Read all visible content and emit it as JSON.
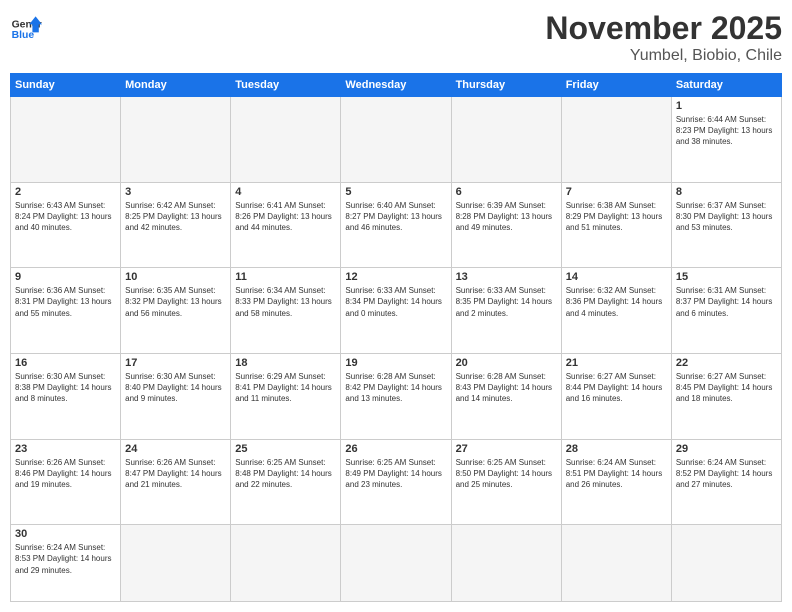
{
  "logo": {
    "general": "General",
    "blue": "Blue"
  },
  "title": "November 2025",
  "location": "Yumbel, Biobio, Chile",
  "days_header": [
    "Sunday",
    "Monday",
    "Tuesday",
    "Wednesday",
    "Thursday",
    "Friday",
    "Saturday"
  ],
  "weeks": [
    [
      {
        "day": "",
        "sunrise": "",
        "sunset": "",
        "daylight": "",
        "empty": true
      },
      {
        "day": "",
        "sunrise": "",
        "sunset": "",
        "daylight": "",
        "empty": true
      },
      {
        "day": "",
        "sunrise": "",
        "sunset": "",
        "daylight": "",
        "empty": true
      },
      {
        "day": "",
        "sunrise": "",
        "sunset": "",
        "daylight": "",
        "empty": true
      },
      {
        "day": "",
        "sunrise": "",
        "sunset": "",
        "daylight": "",
        "empty": true
      },
      {
        "day": "",
        "sunrise": "",
        "sunset": "",
        "daylight": "",
        "empty": true
      },
      {
        "day": "1",
        "info": "Sunrise: 6:44 AM\nSunset: 8:23 PM\nDaylight: 13 hours and 38 minutes."
      }
    ],
    [
      {
        "day": "2",
        "info": "Sunrise: 6:43 AM\nSunset: 8:24 PM\nDaylight: 13 hours and 40 minutes."
      },
      {
        "day": "3",
        "info": "Sunrise: 6:42 AM\nSunset: 8:25 PM\nDaylight: 13 hours and 42 minutes."
      },
      {
        "day": "4",
        "info": "Sunrise: 6:41 AM\nSunset: 8:26 PM\nDaylight: 13 hours and 44 minutes."
      },
      {
        "day": "5",
        "info": "Sunrise: 6:40 AM\nSunset: 8:27 PM\nDaylight: 13 hours and 46 minutes."
      },
      {
        "day": "6",
        "info": "Sunrise: 6:39 AM\nSunset: 8:28 PM\nDaylight: 13 hours and 49 minutes."
      },
      {
        "day": "7",
        "info": "Sunrise: 6:38 AM\nSunset: 8:29 PM\nDaylight: 13 hours and 51 minutes."
      },
      {
        "day": "8",
        "info": "Sunrise: 6:37 AM\nSunset: 8:30 PM\nDaylight: 13 hours and 53 minutes."
      }
    ],
    [
      {
        "day": "9",
        "info": "Sunrise: 6:36 AM\nSunset: 8:31 PM\nDaylight: 13 hours and 55 minutes."
      },
      {
        "day": "10",
        "info": "Sunrise: 6:35 AM\nSunset: 8:32 PM\nDaylight: 13 hours and 56 minutes."
      },
      {
        "day": "11",
        "info": "Sunrise: 6:34 AM\nSunset: 8:33 PM\nDaylight: 13 hours and 58 minutes."
      },
      {
        "day": "12",
        "info": "Sunrise: 6:33 AM\nSunset: 8:34 PM\nDaylight: 14 hours and 0 minutes."
      },
      {
        "day": "13",
        "info": "Sunrise: 6:33 AM\nSunset: 8:35 PM\nDaylight: 14 hours and 2 minutes."
      },
      {
        "day": "14",
        "info": "Sunrise: 6:32 AM\nSunset: 8:36 PM\nDaylight: 14 hours and 4 minutes."
      },
      {
        "day": "15",
        "info": "Sunrise: 6:31 AM\nSunset: 8:37 PM\nDaylight: 14 hours and 6 minutes."
      }
    ],
    [
      {
        "day": "16",
        "info": "Sunrise: 6:30 AM\nSunset: 8:38 PM\nDaylight: 14 hours and 8 minutes."
      },
      {
        "day": "17",
        "info": "Sunrise: 6:30 AM\nSunset: 8:40 PM\nDaylight: 14 hours and 9 minutes."
      },
      {
        "day": "18",
        "info": "Sunrise: 6:29 AM\nSunset: 8:41 PM\nDaylight: 14 hours and 11 minutes."
      },
      {
        "day": "19",
        "info": "Sunrise: 6:28 AM\nSunset: 8:42 PM\nDaylight: 14 hours and 13 minutes."
      },
      {
        "day": "20",
        "info": "Sunrise: 6:28 AM\nSunset: 8:43 PM\nDaylight: 14 hours and 14 minutes."
      },
      {
        "day": "21",
        "info": "Sunrise: 6:27 AM\nSunset: 8:44 PM\nDaylight: 14 hours and 16 minutes."
      },
      {
        "day": "22",
        "info": "Sunrise: 6:27 AM\nSunset: 8:45 PM\nDaylight: 14 hours and 18 minutes."
      }
    ],
    [
      {
        "day": "23",
        "info": "Sunrise: 6:26 AM\nSunset: 8:46 PM\nDaylight: 14 hours and 19 minutes."
      },
      {
        "day": "24",
        "info": "Sunrise: 6:26 AM\nSunset: 8:47 PM\nDaylight: 14 hours and 21 minutes."
      },
      {
        "day": "25",
        "info": "Sunrise: 6:25 AM\nSunset: 8:48 PM\nDaylight: 14 hours and 22 minutes."
      },
      {
        "day": "26",
        "info": "Sunrise: 6:25 AM\nSunset: 8:49 PM\nDaylight: 14 hours and 23 minutes."
      },
      {
        "day": "27",
        "info": "Sunrise: 6:25 AM\nSunset: 8:50 PM\nDaylight: 14 hours and 25 minutes."
      },
      {
        "day": "28",
        "info": "Sunrise: 6:24 AM\nSunset: 8:51 PM\nDaylight: 14 hours and 26 minutes."
      },
      {
        "day": "29",
        "info": "Sunrise: 6:24 AM\nSunset: 8:52 PM\nDaylight: 14 hours and 27 minutes."
      }
    ],
    [
      {
        "day": "30",
        "info": "Sunrise: 6:24 AM\nSunset: 8:53 PM\nDaylight: 14 hours and 29 minutes."
      },
      {
        "day": "",
        "empty": true
      },
      {
        "day": "",
        "empty": true
      },
      {
        "day": "",
        "empty": true
      },
      {
        "day": "",
        "empty": true
      },
      {
        "day": "",
        "empty": true
      },
      {
        "day": "",
        "empty": true
      }
    ]
  ]
}
